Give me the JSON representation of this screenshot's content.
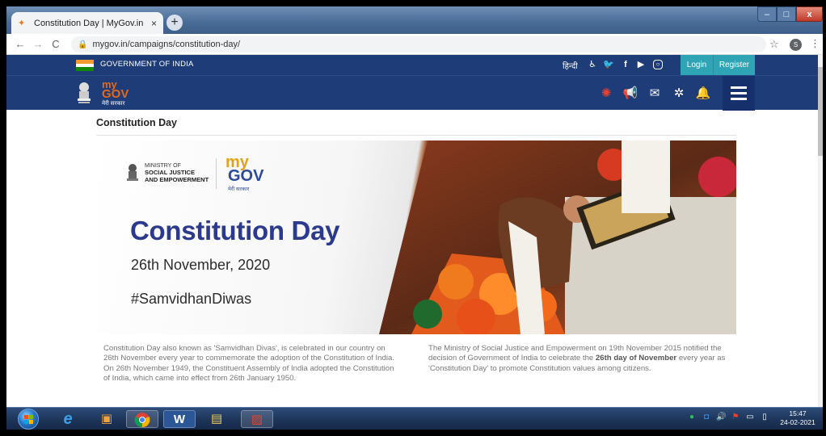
{
  "browser": {
    "tab_title": "Constitution Day | MyGov.in",
    "tab_close": "×",
    "new_tab": "+",
    "url": "mygov.in/campaigns/constitution-day/",
    "profile_initial": "S",
    "window_controls": {
      "minimize": "–",
      "maximize": "□",
      "close": "x"
    }
  },
  "gov_header": {
    "title": "GOVERNMENT OF INDIA",
    "hindi_link": "हिन्दी",
    "login": "Login",
    "register": "Register",
    "social_icons": [
      "accessibility-icon",
      "twitter-icon",
      "facebook-icon",
      "youtube-icon",
      "instagram-icon"
    ]
  },
  "mygov_logo": {
    "my": "my",
    "gov": "GOV",
    "hindi": "मेरी सरकार"
  },
  "nav_icons": [
    "covid-icon",
    "megaphone-icon",
    "mail-icon",
    "settings-icon",
    "bell-icon",
    "menu-icon"
  ],
  "page": {
    "title": "Constitution Day",
    "banner": {
      "ministry_line1": "MINISTRY OF",
      "ministry_line2": "SOCIAL JUSTICE",
      "ministry_line3": "AND EMPOWERMENT",
      "logo_my": "my",
      "logo_gov": "GOV",
      "logo_hindi": "मेरी सरकार",
      "heading": "Constitution Day",
      "date": "26th November, 2020",
      "hashtag": "#SamvidhanDiwas"
    },
    "para_left": "Constitution Day also known as 'Samvidhan Divas', is celebrated in our country on 26th November every year to commemorate the adoption of the Constitution of India. On 26th November 1949, the Constituent Assembly of India adopted the Constitution of India, which came into effect from 26th January 1950.",
    "para_right_1": "The Ministry of Social Justice and Empowerment on 19th November 2015 notified the decision of Government of India to celebrate the ",
    "para_right_bold": "26th day of November",
    "para_right_2": " every year as 'Constitution Day' to promote Constitution values among citizens."
  },
  "taskbar": {
    "time": "15:47",
    "date": "24-02-2021",
    "apps": [
      "internet-explorer-icon",
      "media-player-icon",
      "chrome-icon",
      "word-icon",
      "file-explorer-icon",
      "paint-icon"
    ]
  },
  "colors": {
    "gov_blue": "#1e3c78",
    "teal": "#2fa4b5",
    "mygov_orange": "#e36a1c",
    "banner_title": "#2b3a8c"
  }
}
